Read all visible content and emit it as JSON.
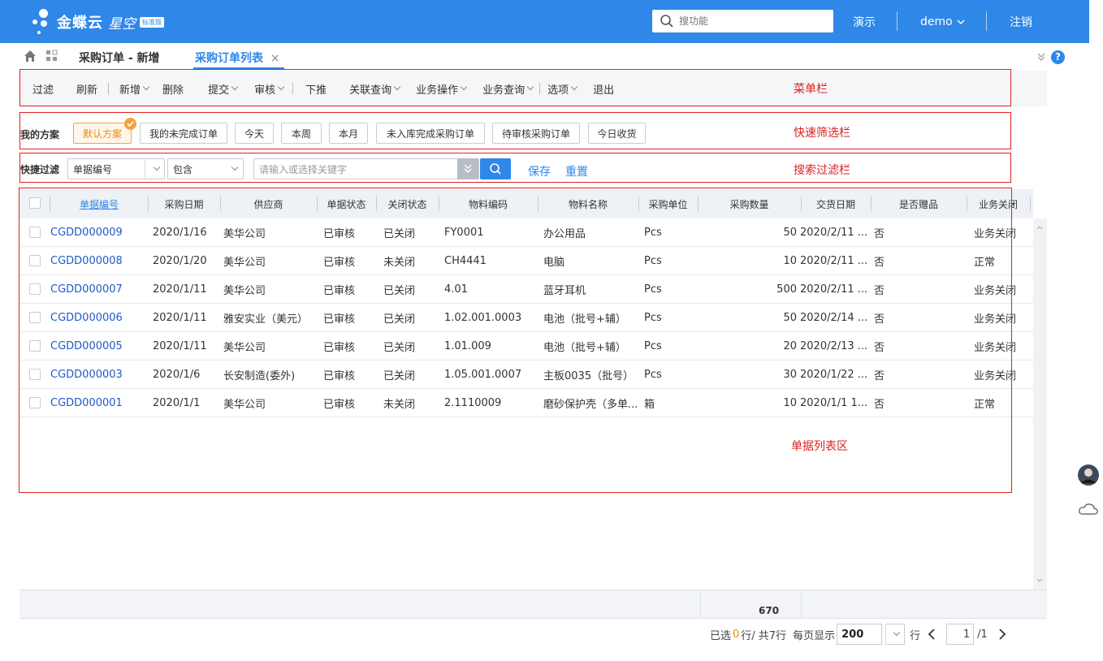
{
  "header": {
    "brand": "金蝶云",
    "product": "星空",
    "edition_badge": "标准版",
    "search_placeholder": "搜功能",
    "demo_label": "演示",
    "user_label": "demo",
    "logout_label": "注销"
  },
  "tabs": [
    {
      "label": "采购订单 - 新增",
      "active": false
    },
    {
      "label": "采购订单列表",
      "active": true
    }
  ],
  "toolbar": {
    "items": [
      {
        "label": "过滤",
        "dropdown": false
      },
      {
        "label": "刷新",
        "dropdown": false
      },
      {
        "label": "新增",
        "dropdown": true
      },
      {
        "label": "删除",
        "dropdown": false
      },
      {
        "label": "提交",
        "dropdown": true
      },
      {
        "label": "审核",
        "dropdown": true
      },
      {
        "label": "下推",
        "dropdown": false
      },
      {
        "label": "关联查询",
        "dropdown": true
      },
      {
        "label": "业务操作",
        "dropdown": true
      },
      {
        "label": "业务查询",
        "dropdown": true
      },
      {
        "label": "选项",
        "dropdown": true
      },
      {
        "label": "退出",
        "dropdown": false
      }
    ]
  },
  "annotations": {
    "menu": "菜单栏",
    "quick_filter": "快速筛选栏",
    "search_filter": "搜索过滤栏",
    "list_area": "单据列表区"
  },
  "schemes": {
    "title": "我的方案",
    "items": [
      "默认方案",
      "我的未完成订单",
      "今天",
      "本周",
      "本月",
      "未入库完成采购订单",
      "待审核采购订单",
      "今日收货"
    ],
    "active_index": 0
  },
  "filter": {
    "label": "快捷过滤",
    "field": "单据编号",
    "operator": "包含",
    "keyword_placeholder": "请输入或选择关键字",
    "save_label": "保存",
    "reset_label": "重置"
  },
  "table": {
    "columns": [
      "单据编号",
      "采购日期",
      "供应商",
      "单据状态",
      "关闭状态",
      "物料编码",
      "物料名称",
      "采购单位",
      "采购数量",
      "交货日期",
      "是否赠品",
      "业务关闭"
    ],
    "rows": [
      [
        "CGDD000009",
        "2020/1/16",
        "美华公司",
        "已审核",
        "已关闭",
        "FY0001",
        "办公用品",
        "Pcs",
        "50",
        "2020/2/11 ...",
        "否",
        "业务关闭"
      ],
      [
        "CGDD000008",
        "2020/1/20",
        "美华公司",
        "已审核",
        "未关闭",
        "CH4441",
        "电脑",
        "Pcs",
        "10",
        "2020/2/11 ...",
        "否",
        "正常"
      ],
      [
        "CGDD000007",
        "2020/1/11",
        "美华公司",
        "已审核",
        "已关闭",
        "4.01",
        "蓝牙耳机",
        "Pcs",
        "500",
        "2020/2/11 ...",
        "否",
        "业务关闭"
      ],
      [
        "CGDD000006",
        "2020/1/11",
        "雅安实业（美元）",
        "已审核",
        "已关闭",
        "1.02.001.0003",
        "电池（批号+辅）",
        "Pcs",
        "50",
        "2020/2/14 ...",
        "否",
        "业务关闭"
      ],
      [
        "CGDD000005",
        "2020/1/11",
        "美华公司",
        "已审核",
        "已关闭",
        "1.01.009",
        "电池（批号+辅）",
        "Pcs",
        "20",
        "2020/2/13 ...",
        "否",
        "业务关闭"
      ],
      [
        "CGDD000003",
        "2020/1/6",
        "长安制造(委外)",
        "已审核",
        "已关闭",
        "1.05.001.0007",
        "主板0035（批号）",
        "Pcs",
        "30",
        "2020/1/22 ...",
        "否",
        "业务关闭"
      ],
      [
        "CGDD000001",
        "2020/1/1",
        "美华公司",
        "已审核",
        "未关闭",
        "2.1110009",
        "磨砂保护壳（多单...",
        "箱",
        "10",
        "2020/1/1 1...",
        "否",
        "正常"
      ]
    ],
    "total_quantity": "670"
  },
  "pager": {
    "selected_prefix": "已选",
    "selected_count": "0",
    "selected_suffix": "行/ 共7行",
    "per_page_label": "每页显示",
    "page_size": "200",
    "row_unit": "行",
    "current_page": "1",
    "total_pages": "/1"
  },
  "colors": {
    "primary": "#2f87e8",
    "annotation_red": "#e02020",
    "active_scheme": "#f7a23a"
  }
}
